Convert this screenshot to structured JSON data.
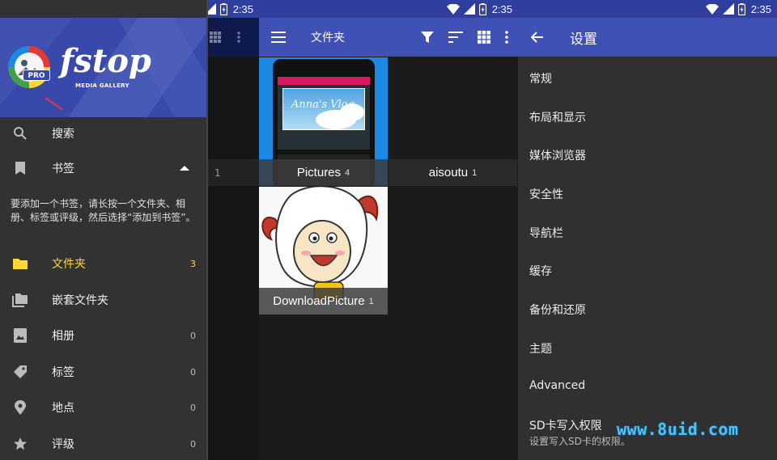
{
  "status_bar": {
    "time": "2:35"
  },
  "drawer": {
    "brand": {
      "name": "fstop",
      "subtitle": "MEDIA GALLERY",
      "badge": "PRO"
    },
    "items": [
      {
        "label": "搜索",
        "icon": "search-icon"
      },
      {
        "label": "书签",
        "icon": "bookmark-icon",
        "expanded": true
      },
      {
        "label": "文件夹",
        "icon": "folder-icon",
        "count": "3",
        "active": true
      },
      {
        "label": "嵌套文件夹",
        "icon": "nested-folders-icon"
      },
      {
        "label": "相册",
        "icon": "album-icon",
        "count": "0"
      },
      {
        "label": "标签",
        "icon": "tag-icon",
        "count": "0"
      },
      {
        "label": "地点",
        "icon": "location-pin-icon",
        "count": "0"
      },
      {
        "label": "评级",
        "icon": "star-icon",
        "count": "0"
      }
    ],
    "bookmark_hint": "要添加一个书签，请长按一个文件夹、相册、标签或评级，然后选择“添加到书签”。",
    "behind_count": "1",
    "accent_color": "#fdd835"
  },
  "folders_screen": {
    "title": "文件夹",
    "tiles": [
      {
        "name": "Pictures",
        "count": "4",
        "thumb_text": "Anna's Vlog"
      },
      {
        "name": "aisoutu",
        "count": "1"
      },
      {
        "name": "DownloadPicture",
        "count": "1"
      }
    ]
  },
  "settings_screen": {
    "title": "设置",
    "items": [
      {
        "label": "常规"
      },
      {
        "label": "布局和显示"
      },
      {
        "label": "媒体浏览器"
      },
      {
        "label": "安全性"
      },
      {
        "label": "导航栏"
      },
      {
        "label": "缓存"
      },
      {
        "label": "备份和还原"
      },
      {
        "label": "主题"
      },
      {
        "label": "Advanced"
      },
      {
        "label": "SD卡写入权限",
        "subtitle": "设置写入SD卡的权限。"
      }
    ]
  },
  "watermark": "www.8uid.com",
  "colors": {
    "appbar": "#3f51b5",
    "statusbar": "#303f9f",
    "drawer_bg": "#323232",
    "settings_bg": "#303030"
  }
}
